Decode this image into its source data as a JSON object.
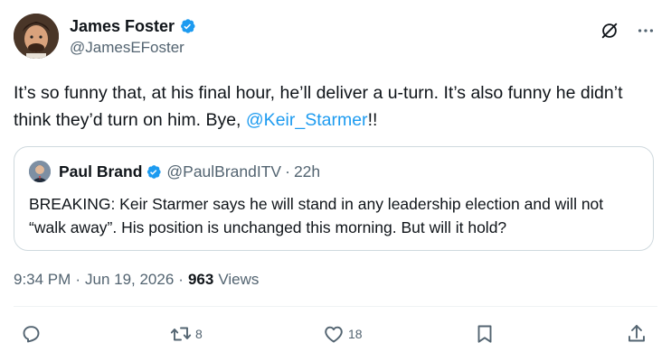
{
  "author": {
    "display_name": "James Foster",
    "handle": "@JamesEFoster"
  },
  "tweet": {
    "text_main": "It’s so funny that, at his final hour, he’ll deliver a u-turn.  It’s also funny he didn’t think they’d turn on him.  Bye, ",
    "mention": "@Keir_Starmer",
    "text_tail": "!!"
  },
  "quote": {
    "display_name": "Paul Brand",
    "handle": "@PaulBrandITV",
    "separator": "·",
    "time": "22h",
    "text": "BREAKING: Keir Starmer says he will stand in any leadership election and will not “walk away”. His position is unchanged this morning. But will it hold?"
  },
  "meta": {
    "time": "9:34 PM",
    "dot1": "·",
    "date": "Jun 19, 2026",
    "dot2": "·",
    "views_count": "963",
    "views_label": "Views"
  },
  "actions": {
    "reply_count": "",
    "retweet_count": "8",
    "like_count": "18"
  },
  "colors": {
    "accent": "#1d9bf0",
    "text_primary": "#0f1419",
    "text_secondary": "#536471",
    "border": "#cfd9de"
  },
  "icons": [
    "grok-icon",
    "more-icon",
    "verified-badge-icon",
    "reply-icon",
    "retweet-icon",
    "like-icon",
    "bookmark-icon",
    "share-icon"
  ]
}
